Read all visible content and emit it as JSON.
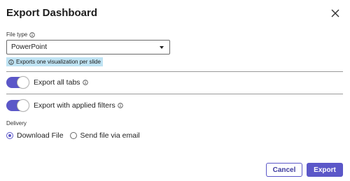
{
  "dialog": {
    "title": "Export Dashboard",
    "close_icon": "close-icon"
  },
  "file_type": {
    "label": "File type",
    "info_icon": "info-icon",
    "selected": "PowerPoint",
    "hint": "Exports one visualization per slide"
  },
  "toggles": [
    {
      "label": "Export all tabs",
      "on": true,
      "info_icon": "info-icon"
    },
    {
      "label": "Export with applied filters",
      "on": true,
      "info_icon": "info-icon"
    }
  ],
  "delivery": {
    "label": "Delivery",
    "options": [
      {
        "label": "Download File",
        "checked": true
      },
      {
        "label": "Send file via email",
        "checked": false
      }
    ]
  },
  "footer": {
    "cancel_label": "Cancel",
    "export_label": "Export"
  },
  "colors": {
    "accent": "#5b57c8",
    "hint_bg": "#bfe3f3"
  }
}
